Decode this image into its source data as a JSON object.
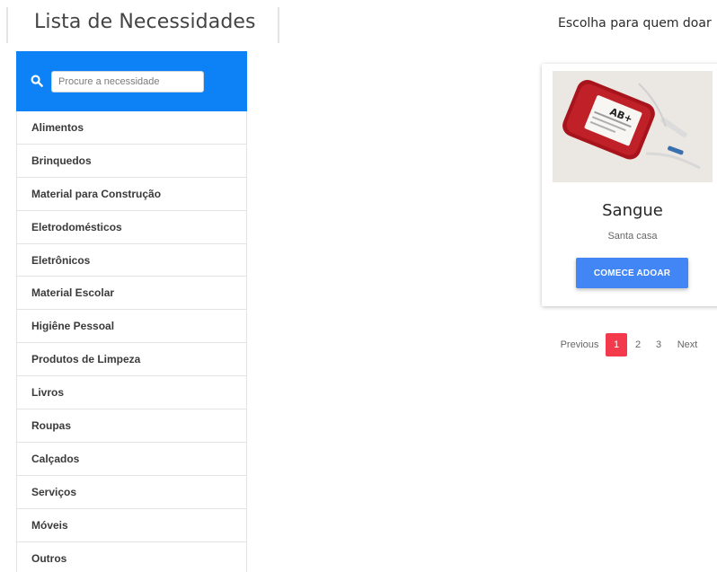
{
  "header": {
    "title": "Lista de Necessidades",
    "subtitle": "Escolha para quem doar"
  },
  "search": {
    "icon": "search-icon",
    "placeholder": "Procure a necessidade",
    "value": ""
  },
  "colors": {
    "accent": "#0d82f6",
    "button": "#4285f4",
    "active_page": "#f33a4c"
  },
  "categories": [
    "Alimentos",
    "Brinquedos",
    "Material para Construção",
    "Eletrodomésticos",
    "Eletrônicos",
    "Material Escolar",
    "Higiêne Pessoal",
    "Produtos de Limpeza",
    "Livros",
    "Roupas",
    "Calçados",
    "Serviços",
    "Móveis",
    "Outros"
  ],
  "card": {
    "title": "Sangue",
    "subtitle": "Santa casa",
    "button_label": "COMECE ADOAR",
    "image": {
      "label_text": "AB+"
    }
  },
  "pagination": {
    "previous": "Previous",
    "pages": [
      "1",
      "2",
      "3"
    ],
    "current": "1",
    "next": "Next"
  }
}
